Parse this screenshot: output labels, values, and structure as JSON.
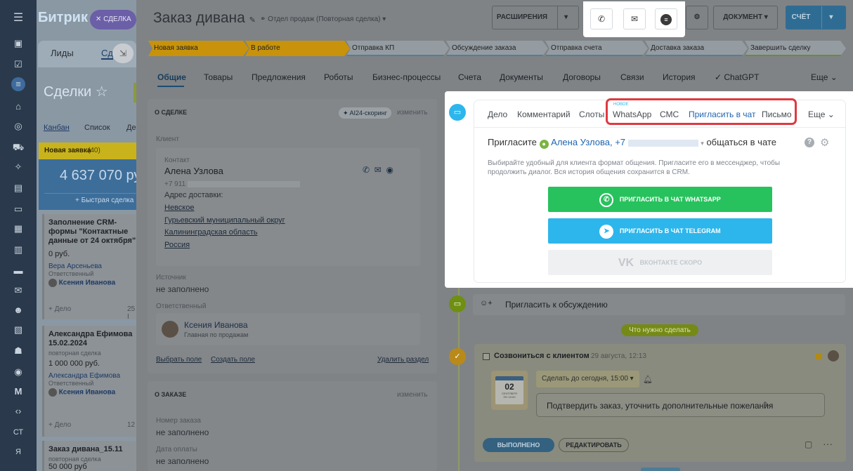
{
  "rail": {
    "icons": [
      "menu-icon",
      "home-icon",
      "tasks-icon",
      "filter-icon",
      "bank-icon",
      "target-icon",
      "cart-icon",
      "puzzle-icon",
      "doc-icon",
      "chat-icon",
      "calendar-icon",
      "file-icon",
      "folder-icon",
      "mail-icon",
      "people-icon",
      "id-card-icon",
      "robot-icon",
      "box-icon",
      "m-icon",
      "code-icon"
    ],
    "labels": {
      "ct": "СТ",
      "ya": "Я"
    }
  },
  "crm": {
    "brand": "Битрик",
    "deal_badge": "СДЕЛКА",
    "tab_leads": "Лиды",
    "tab_deals": "Сд",
    "title": "Сделки",
    "views": [
      "Канбан",
      "Список",
      "Де"
    ],
    "column": {
      "name": "Новая заявка",
      "count": "(40)",
      "sum": "4 637 070 ру",
      "quick": "Быстрая сделка"
    },
    "cards": [
      {
        "title": "Заполнение CRM-формы \"Контактные данные от 24 октября\"",
        "amount": "0 руб.",
        "contact": "Вера Арсеньева",
        "role": "Ответственный",
        "person": "Ксения Иванова",
        "add": "+ Дело",
        "extra": "25 I"
      },
      {
        "title": "Александра Ефимова 15.02.2024",
        "type": "повторная сделка",
        "amount": "1 000 000 руб.",
        "contact": "Александра Ефимова",
        "role": "Ответственный",
        "person": "Ксения Иванова",
        "add": "+ Дело",
        "extra": "12"
      },
      {
        "title": "Заказ дивана_15.11",
        "type": "повторная сделка",
        "amount": "50 000 руб"
      }
    ]
  },
  "deal": {
    "title": "Заказ дивана",
    "subtitle": "Отдел продаж (Повторная сделка)",
    "buttons": {
      "ext": "РАСШИРЕНИЯ",
      "doc": "ДОКУМЕНТ",
      "bill": "СЧЁТ"
    },
    "stages": [
      {
        "name": "Новая заявка",
        "color": "#c8930a"
      },
      {
        "name": "В работе",
        "color": "#c8930a"
      },
      {
        "name": "Отправка КП",
        "color": "#9aa2a8"
      },
      {
        "name": "Обсуждение заказа",
        "color": "#9aa2a8"
      },
      {
        "name": "Отправка счета",
        "color": "#9aa2a8"
      },
      {
        "name": "Доставка заказа",
        "color": "#9aa2a8"
      },
      {
        "name": "Завершить сделку",
        "color": "#9aa2a8"
      }
    ],
    "tabs": [
      "Общие",
      "Товары",
      "Предложения",
      "Роботы",
      "Бизнес-процессы",
      "Счета",
      "Документы",
      "Договоры",
      "Связи",
      "История",
      "✓ ChatGPT",
      "Еще"
    ],
    "about": {
      "header": "О СДЕЛКЕ",
      "ai": "AI24-скоринг",
      "change": "изменить",
      "client_label": "Клиент",
      "contact_label": "Контакт",
      "contact_name": "Алена Узлова",
      "phone": "+7 911",
      "address_label": "Адрес доставки:",
      "address": [
        "Невское",
        "Гурьевский муниципальный округ",
        "Калининградская область",
        "Россия"
      ],
      "source_label": "Источник",
      "source_value": "не заполнено",
      "resp_label": "Ответственный",
      "resp_name": "Ксения Иванова",
      "resp_role": "Главная по продажам",
      "links": {
        "select": "Выбрать поле",
        "create": "Создать поле",
        "delete": "Удалить раздел"
      }
    },
    "order": {
      "header": "О ЗАКАЗЕ",
      "change": "изменить",
      "num_label": "Номер заказа",
      "num_value": "не заполнено",
      "date_label": "Дата оплаты",
      "date_value": "не заполнено"
    }
  },
  "popup": {
    "tabs": [
      "Дело",
      "Комментарий",
      "Слоты",
      "WhatsApp",
      "СМС",
      "Пригласить в чат",
      "Письмо",
      "Еще"
    ],
    "new_badge": "НОВОЕ",
    "invite_prefix": "Пригласите",
    "invite_name": "Алена Узлова",
    "invite_phone": "+7",
    "invite_suffix": "общаться в чате",
    "desc": "Выбирайте удобный для клиента формат общения. Пригласите его в мессенджер, чтобы продолжить диалог. Вся история общения сохранится в CRM.",
    "btn_whatsapp": "ПРИГЛАСИТЬ В ЧАТ WHATSAPP",
    "btn_telegram": "ПРИГЛАСИТЬ В ЧАТ TELEGRAM",
    "btn_vk": "ВКОНТАКТЕ СКОРО",
    "colors": {
      "whatsapp": "#27c25d",
      "telegram": "#2db6ec",
      "vk": "#eef0f2",
      "highlight": "#e0393e"
    }
  },
  "timeline": {
    "invite_discuss": "Пригласить к обсуждению",
    "todo_badge": "Что нужно сделать",
    "task_title": "Созвониться с клиентом",
    "task_date": "29 августа, 12:13",
    "deadline": "Сделать до сегодня, 15:00",
    "cal_day": "02",
    "cal_month": "СЕНТЯБРЯ",
    "cal_wd": "ПН 15:00",
    "note": "Подтвердить заказ, уточнить дополнительные пожелания",
    "done": "ВЫПОЛНЕНО",
    "edit": "РЕДАКТИРОВАТЬ"
  }
}
